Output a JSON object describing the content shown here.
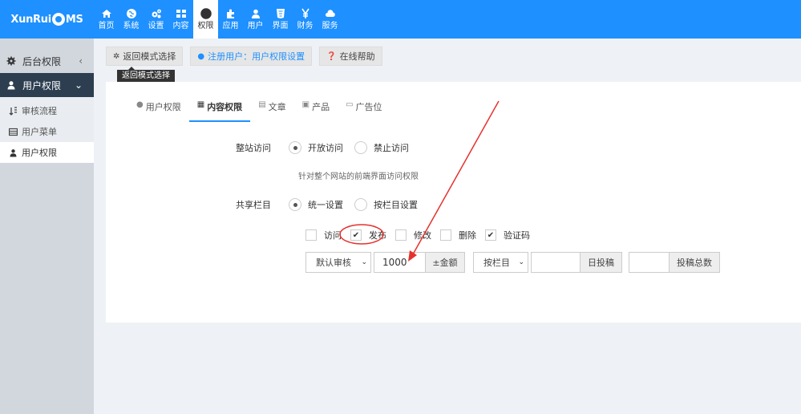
{
  "brand": {
    "name_left": "XunRui",
    "name_right": "MS"
  },
  "nav": [
    {
      "label": "首页",
      "icon": "home-icon"
    },
    {
      "label": "系统",
      "icon": "globe-icon"
    },
    {
      "label": "设置",
      "icon": "cogs-icon"
    },
    {
      "label": "内容",
      "icon": "grid-icon"
    },
    {
      "label": "权限",
      "icon": "user-circle-icon",
      "active": true
    },
    {
      "label": "应用",
      "icon": "puzzle-icon"
    },
    {
      "label": "用户",
      "icon": "user-icon"
    },
    {
      "label": "界面",
      "icon": "html5-icon"
    },
    {
      "label": "财务",
      "icon": "yen-icon"
    },
    {
      "label": "服务",
      "icon": "cloud-icon"
    }
  ],
  "sidebar": {
    "sections": [
      {
        "label": "后台权限",
        "icon": "gear-icon",
        "chevron": "‹"
      },
      {
        "label": "用户权限",
        "icon": "user-icon",
        "chevron": "⌄"
      }
    ],
    "items": [
      {
        "label": "审核流程",
        "icon": "sort-icon"
      },
      {
        "label": "用户菜单",
        "icon": "table-icon"
      },
      {
        "label": "用户权限",
        "icon": "user-icon"
      }
    ]
  },
  "toolbar": {
    "back": "返回模式选择",
    "register": "注册用户：用户权限设置",
    "help": "在线帮助",
    "tooltip": "返回模式选择"
  },
  "tabs": [
    {
      "label": "用户权限",
      "icon": "user-icon"
    },
    {
      "label": "内容权限",
      "icon": "table-icon",
      "active": true
    },
    {
      "label": "文章",
      "icon": "doc-icon"
    },
    {
      "label": "产品",
      "icon": "file-icon"
    },
    {
      "label": "广告位",
      "icon": "image-icon"
    }
  ],
  "site_access": {
    "label": "整站访问",
    "options": [
      "开放访问",
      "禁止访问"
    ],
    "selected": 0,
    "help": "针对整个网站的前端界面访问权限"
  },
  "shared_column": {
    "label": "共享栏目",
    "options": [
      "统一设置",
      "按栏目设置"
    ],
    "selected": 0
  },
  "permissions": [
    {
      "label": "访问",
      "checked": false
    },
    {
      "label": "发布",
      "checked": true
    },
    {
      "label": "修改",
      "checked": false
    },
    {
      "label": "删除",
      "checked": false
    },
    {
      "label": "验证码",
      "checked": true
    }
  ],
  "controls": {
    "review_select": "默认审核",
    "amount_value": "1000",
    "amount_addon": "±金额",
    "column_select": "按栏目",
    "daily_value": "",
    "daily_addon": "日投稿",
    "total_value": "",
    "total_addon": "投稿总数"
  },
  "colors": {
    "primary": "#1e90ff",
    "sidebar_active": "#2c3e50",
    "annotation": "#e5322d"
  }
}
